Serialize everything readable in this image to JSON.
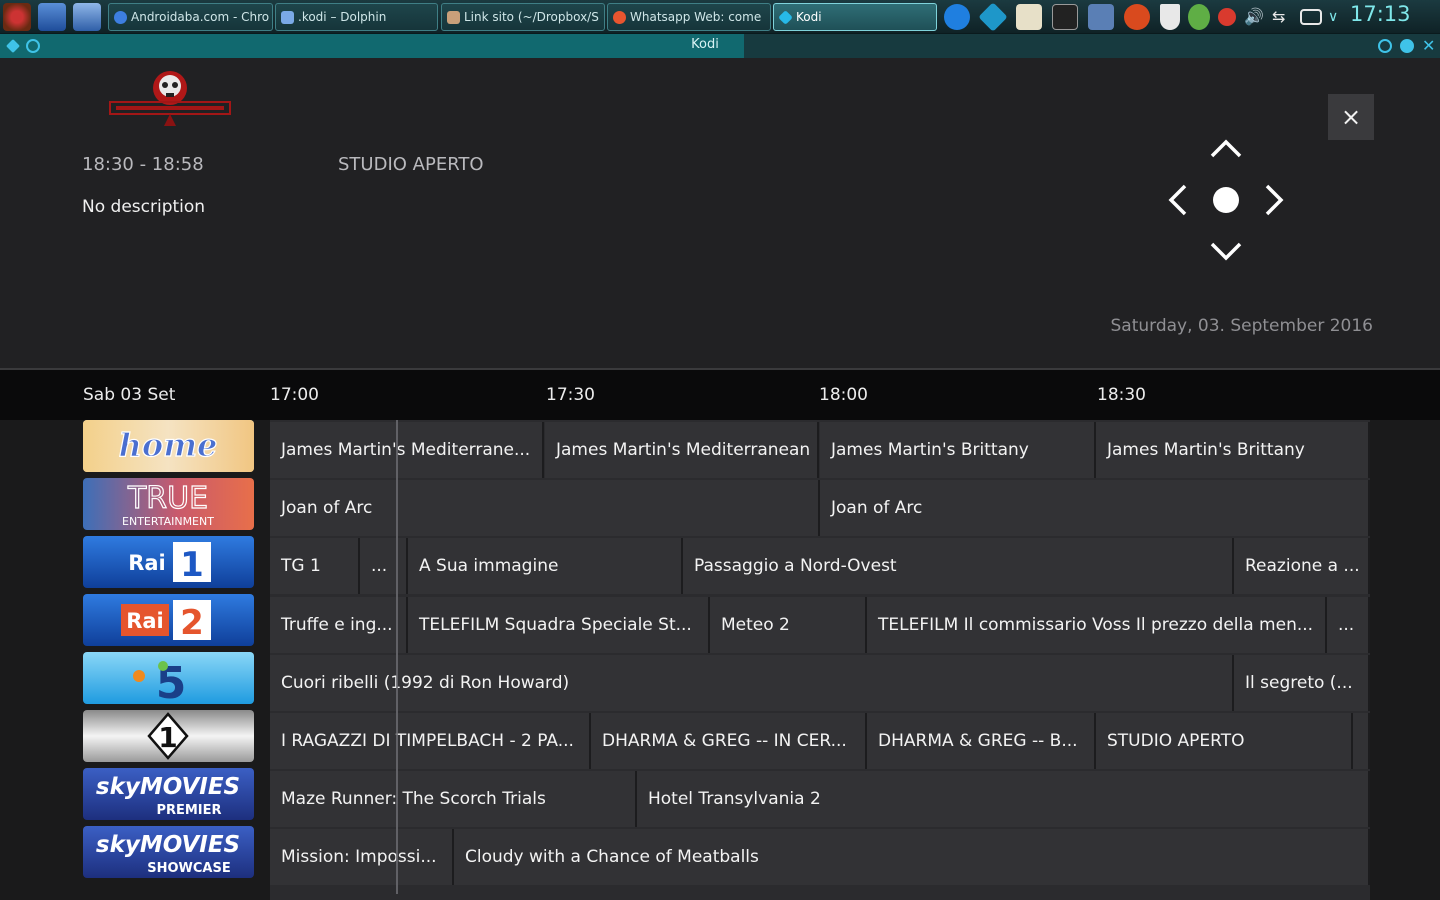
{
  "taskbar": {
    "tasks": [
      {
        "label": "Androidaba.com - Chro"
      },
      {
        "label": ".kodi – Dolphin"
      },
      {
        "label": "Link sito (~/Dropbox/S"
      },
      {
        "label": "Whatsapp Web: come"
      },
      {
        "label": "Kodi"
      }
    ],
    "clock": "17:13"
  },
  "window": {
    "title": "Kodi"
  },
  "info": {
    "time_range": "18:30 - 18:58",
    "title": "STUDIO APERTO",
    "description": "No description",
    "date_full": "Saturday, 03. September 2016",
    "close_label": "×"
  },
  "guide": {
    "day_label": "Sab 03 Set",
    "time_labels": [
      "17:00",
      "17:30",
      "18:00",
      "18:30"
    ],
    "channels": [
      {
        "name": "home",
        "icon": "home-channel-logo"
      },
      {
        "name": "TRUE",
        "sub": "ENTERTAINMENT",
        "icon": "true-entertainment-logo"
      },
      {
        "name": "Rai",
        "num": "1",
        "icon": "rai-1-logo"
      },
      {
        "name": "Rai",
        "num": "2",
        "icon": "rai-2-logo"
      },
      {
        "name": "5",
        "icon": "canale-5-logo"
      },
      {
        "name": "1",
        "icon": "italia-1-logo"
      },
      {
        "name": "skyMOVIES",
        "sub": "PREMIER",
        "icon": "sky-movies-premier-logo"
      },
      {
        "name": "skyMOVIES",
        "sub": "SHOWCASE",
        "icon": "sky-movies-showcase-logo"
      }
    ],
    "rows": [
      [
        "James Martin's Mediterrane...",
        "James Martin's Mediterranean",
        "James Martin's Brittany",
        "James Martin's Brittany"
      ],
      [
        "Joan of Arc",
        "Joan of Arc"
      ],
      [
        "TG 1",
        "...",
        "A Sua immagine",
        "Passaggio a Nord-Ovest",
        "Reazione a ..."
      ],
      [
        "Truffe e ing...",
        "TELEFILM Squadra Speciale St...",
        "Meteo 2",
        "TELEFILM Il commissario Voss Il prezzo della men...",
        "..."
      ],
      [
        "Cuori ribelli (1992 di Ron Howard)",
        "Il segreto (..."
      ],
      [
        "I RAGAZZI DI TIMPELBACH - 2 PA...",
        "DHARMA & GREG -- IN CER...",
        "DHARMA & GREG -- B...",
        "STUDIO APERTO",
        ""
      ],
      [
        "Maze Runner: The Scorch Trials",
        "Hotel Transylvania 2"
      ],
      [
        "Mission: Impossi...",
        "Cloudy with a Chance of Meatballs"
      ]
    ]
  },
  "colors": {
    "accent": "#11696f",
    "background": "#202022",
    "cell": "#323235"
  }
}
